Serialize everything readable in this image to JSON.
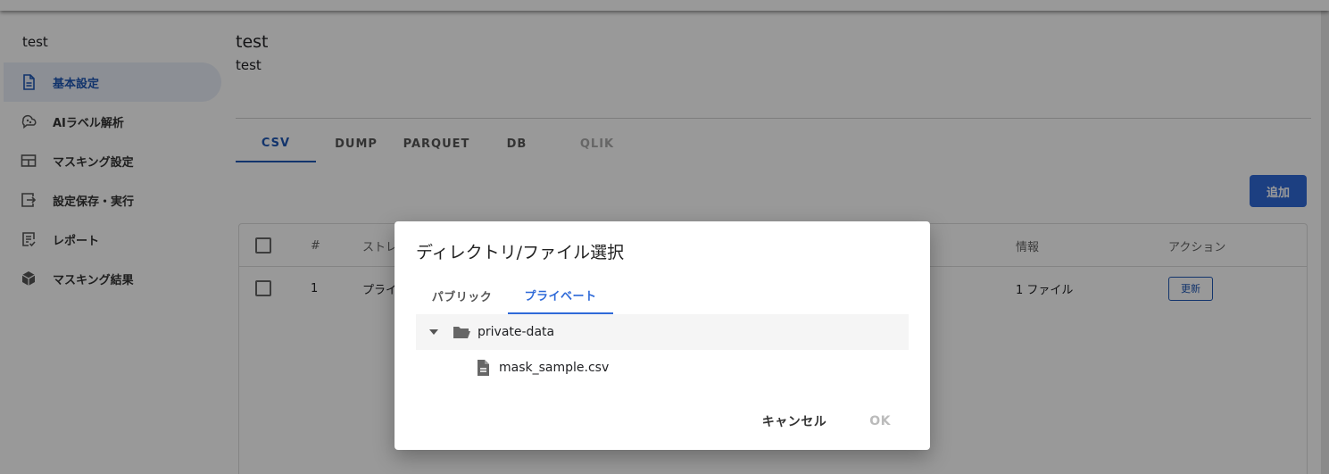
{
  "sidebar": {
    "project_name": "test",
    "items": [
      {
        "label": "基本設定",
        "icon": "document-icon"
      },
      {
        "label": "AIラベル解析",
        "icon": "brain-icon"
      },
      {
        "label": "マスキング設定",
        "icon": "table-icon"
      },
      {
        "label": "設定保存・実行",
        "icon": "save-run-icon"
      },
      {
        "label": "レポート",
        "icon": "report-icon"
      },
      {
        "label": "マスキング結果",
        "icon": "cube-icon"
      }
    ]
  },
  "main": {
    "title": "test",
    "subtitle": "test",
    "tabs": [
      {
        "label": "CSV"
      },
      {
        "label": "DUMP"
      },
      {
        "label": "PARQUET"
      },
      {
        "label": "DB"
      },
      {
        "label": "QLIK"
      }
    ],
    "add_button": "追加",
    "table": {
      "headers": {
        "num": "#",
        "storage": "ストレ",
        "info": "情報",
        "action": "アクション"
      },
      "rows": [
        {
          "num": "1",
          "storage": "プライ",
          "info": "1 ファイル",
          "action": "更新"
        }
      ]
    }
  },
  "dialog": {
    "title": "ディレクトリ/ファイル選択",
    "tabs": [
      {
        "label": "パブリック"
      },
      {
        "label": "プライベート"
      }
    ],
    "tree": {
      "folder": "private-data",
      "file": "mask_sample.csv"
    },
    "cancel": "キャンセル",
    "ok": "OK"
  },
  "colors": {
    "accent": "#2f6ad8",
    "active_nav": "#1f57b5"
  }
}
